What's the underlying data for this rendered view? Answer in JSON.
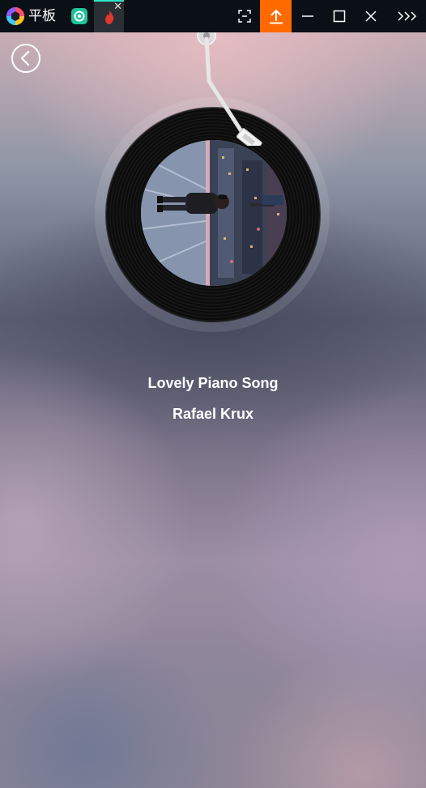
{
  "titlebar": {
    "app_name": "平板",
    "tab_close_glyph": "✕",
    "icons": [
      "app-logo-icon",
      "android-tab-icon",
      "flame-tab-icon",
      "screenshot-icon",
      "upload-icon",
      "minimize-icon",
      "maximize-icon",
      "close-icon",
      "more-icon"
    ],
    "accent_color": "#ff6a00",
    "tab_indicator_color": "#2ee6c8"
  },
  "player": {
    "back_icon": "chevron-left-icon",
    "song_title": "Lovely Piano Song",
    "artist": "Rafael Krux"
  }
}
